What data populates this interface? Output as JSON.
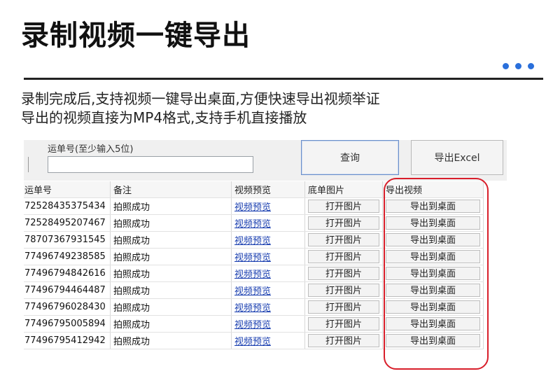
{
  "page": {
    "title": "录制视频一键导出",
    "desc_line1": "录制完成后,支持视频一键导出桌面,方便快速导出视频举证",
    "desc_line2": "导出的视频直接为MP4格式,支持手机直接播放"
  },
  "colors": {
    "accent": "#2a6fdb",
    "highlight": "#d81e2a",
    "link": "#1a3fb0"
  },
  "app": {
    "field_label": "运单号(至少输入5位)",
    "field_value": "",
    "query_label": "查询",
    "excel_label": "导出Excel",
    "columns": [
      "运单号",
      "备注",
      "视频预览",
      "底单图片",
      "导出视频"
    ],
    "rows": [
      {
        "id": "72528435375434",
        "note": "拍照成功",
        "preview": "视频预览",
        "image": "打开图片",
        "export": "导出到桌面"
      },
      {
        "id": "72528495207467",
        "note": "拍照成功",
        "preview": "视频预览",
        "image": "打开图片",
        "export": "导出到桌面"
      },
      {
        "id": "78707367931545",
        "note": "拍照成功",
        "preview": "视频预览",
        "image": "打开图片",
        "export": "导出到桌面"
      },
      {
        "id": "77496749238585",
        "note": "拍照成功",
        "preview": "视频预览",
        "image": "打开图片",
        "export": "导出到桌面"
      },
      {
        "id": "77496794842616",
        "note": "拍照成功",
        "preview": "视频预览",
        "image": "打开图片",
        "export": "导出到桌面"
      },
      {
        "id": "77496794464487",
        "note": "拍照成功",
        "preview": "视频预览",
        "image": "打开图片",
        "export": "导出到桌面"
      },
      {
        "id": "77496796028430",
        "note": "拍照成功",
        "preview": "视频预览",
        "image": "打开图片",
        "export": "导出到桌面"
      },
      {
        "id": "77496795005894",
        "note": "拍照成功",
        "preview": "视频预览",
        "image": "打开图片",
        "export": "导出到桌面"
      },
      {
        "id": "77496795412942",
        "note": "拍照成功",
        "preview": "视频预览",
        "image": "打开图片",
        "export": "导出到桌面"
      }
    ]
  }
}
